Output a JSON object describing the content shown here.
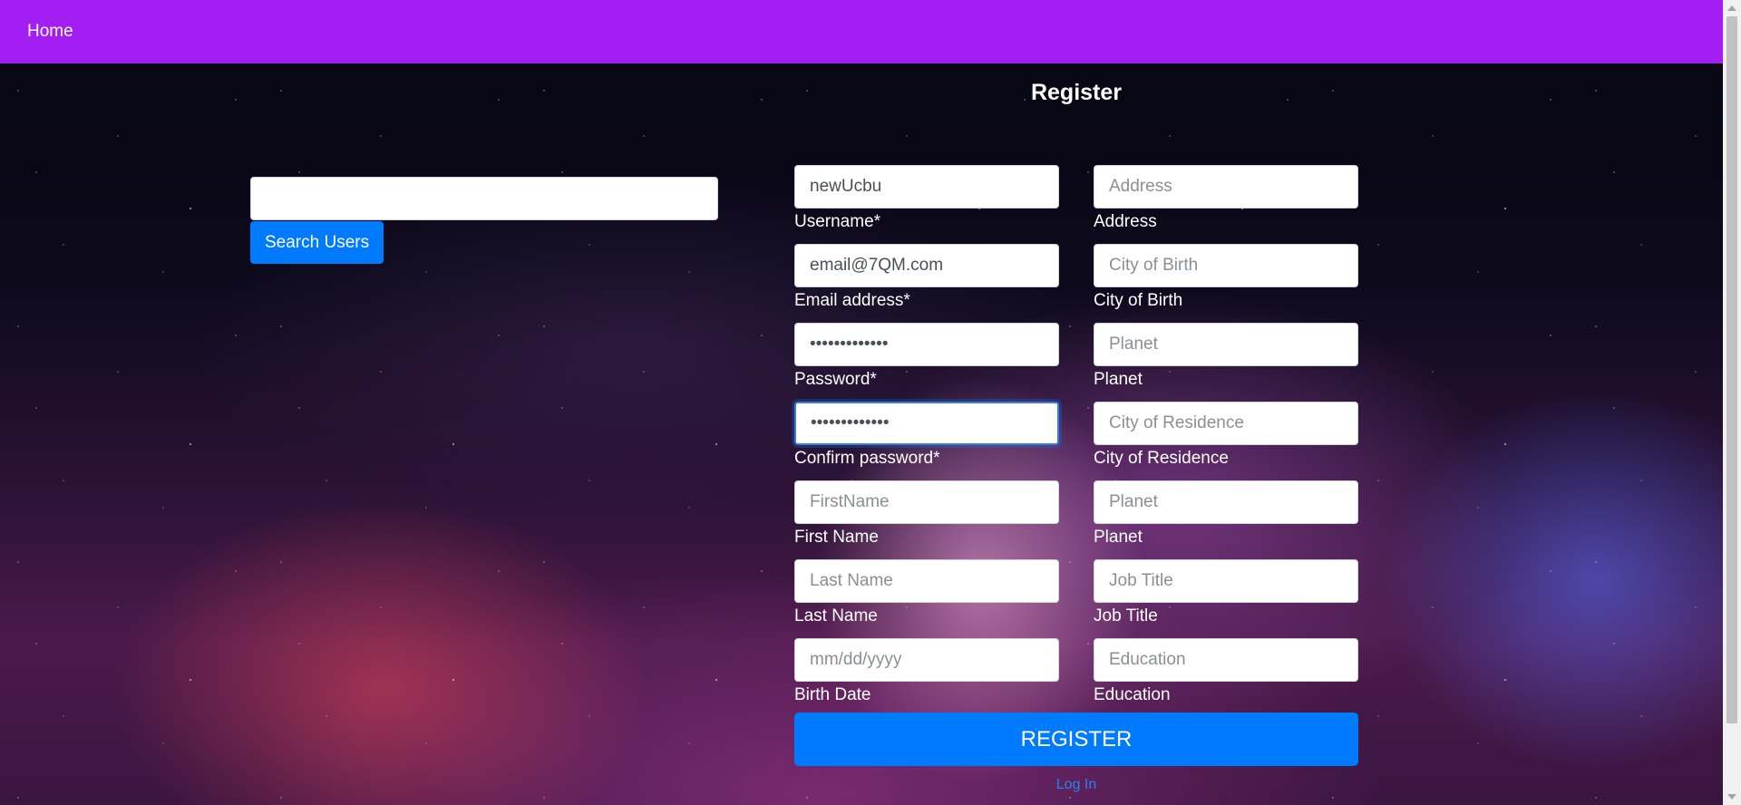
{
  "nav": {
    "home_label": "Home"
  },
  "search": {
    "value": "",
    "button_label": "Search Users"
  },
  "register": {
    "title": "Register",
    "fields": [
      {
        "label": "Username*",
        "value": "newUcbu",
        "placeholder": "",
        "type": "text"
      },
      {
        "label": "Address",
        "value": "",
        "placeholder": "Address",
        "type": "text"
      },
      {
        "label": "Email address*",
        "value": "email@7QM.com",
        "placeholder": "",
        "type": "text"
      },
      {
        "label": "City of Birth",
        "value": "",
        "placeholder": "City of Birth",
        "type": "text"
      },
      {
        "label": "Password*",
        "value": "•••••••••••••",
        "placeholder": "",
        "type": "password"
      },
      {
        "label": "Planet",
        "value": "",
        "placeholder": "Planet",
        "type": "text"
      },
      {
        "label": "Confirm password*",
        "value": "•••••••••••••",
        "placeholder": "",
        "type": "password"
      },
      {
        "label": "City of Residence",
        "value": "",
        "placeholder": "City of Residence",
        "type": "text"
      },
      {
        "label": "First Name",
        "value": "",
        "placeholder": "FirstName",
        "type": "text"
      },
      {
        "label": "Planet",
        "value": "",
        "placeholder": "Planet",
        "type": "text"
      },
      {
        "label": "Last Name",
        "value": "",
        "placeholder": "Last Name",
        "type": "text"
      },
      {
        "label": "Job Title",
        "value": "",
        "placeholder": "Job Title",
        "type": "text"
      },
      {
        "label": "Birth Date",
        "value": "",
        "placeholder": "mm/dd/yyyy",
        "type": "text"
      },
      {
        "label": "Education",
        "value": "",
        "placeholder": "Education",
        "type": "text"
      }
    ],
    "submit_label": "REGISTER",
    "login_link": "Log In"
  }
}
